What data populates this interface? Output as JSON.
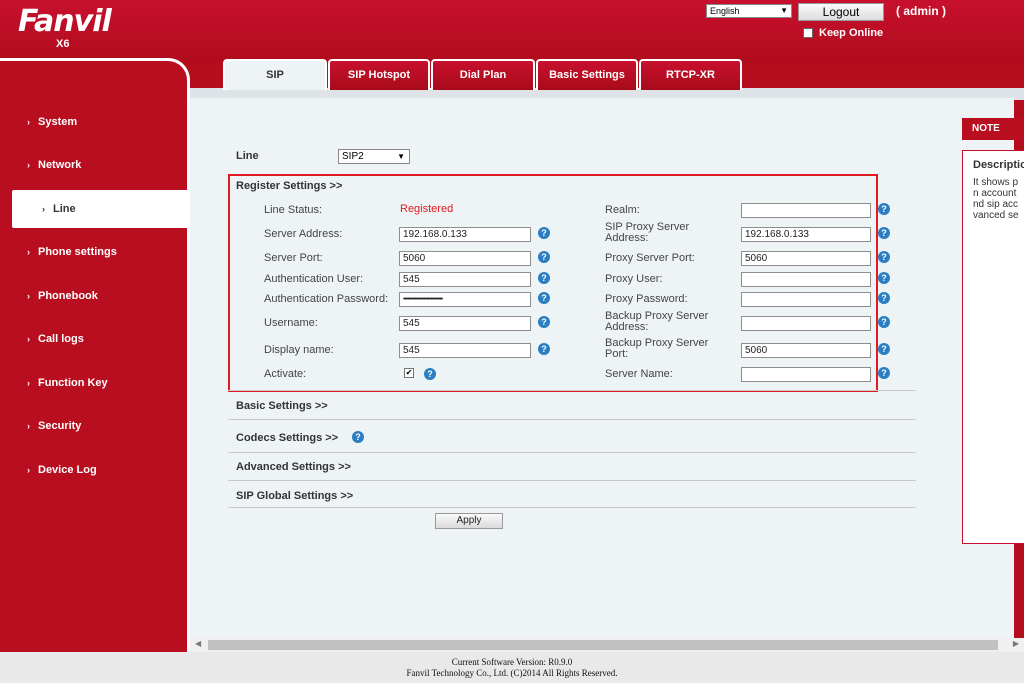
{
  "header": {
    "logo_text": "Fanvil",
    "model": "X6",
    "language": "English",
    "logout_label": "Logout",
    "user": "( admin )",
    "keep_online": "Keep Online"
  },
  "sidebar": {
    "items": [
      {
        "label": "System"
      },
      {
        "label": "Network"
      },
      {
        "label": "Line"
      },
      {
        "label": "Phone settings"
      },
      {
        "label": "Phonebook"
      },
      {
        "label": "Call logs"
      },
      {
        "label": "Function Key"
      },
      {
        "label": "Security"
      },
      {
        "label": "Device Log"
      }
    ],
    "active": "Line"
  },
  "tabs": [
    "SIP",
    "SIP Hotspot",
    "Dial Plan",
    "Basic Settings",
    "RTCP-XR"
  ],
  "line": {
    "label": "Line",
    "selected": "SIP2"
  },
  "register": {
    "title": "Register Settings >>",
    "line_status_label": "Line Status:",
    "line_status_value": "Registered",
    "server_address_label": "Server Address:",
    "server_address": "192.168.0.133",
    "server_port_label": "Server Port:",
    "server_port": "5060",
    "auth_user_label": "Authentication User:",
    "auth_user": "545",
    "auth_password_label": "Authentication Password:",
    "auth_password": "•••••••••••••••••••••••••••",
    "username_label": "Username:",
    "username": "545",
    "display_name_label": "Display name:",
    "display_name": "545",
    "activate_label": "Activate:",
    "activate_check": "✔",
    "realm_label": "Realm:",
    "realm": "",
    "proxy_server_addr_label_1": "SIP Proxy Server",
    "proxy_server_addr_label_2": "Address:",
    "proxy_server_addr": "192.168.0.133",
    "proxy_port_label": "Proxy Server Port:",
    "proxy_port": "5060",
    "proxy_user_label": "Proxy User:",
    "proxy_user": "",
    "proxy_password_label": "Proxy Password:",
    "proxy_password": "",
    "backup_proxy_addr_label_1": "Backup Proxy Server",
    "backup_proxy_addr_label_2": "Address:",
    "backup_proxy_addr": "",
    "backup_proxy_port_label_1": "Backup Proxy Server",
    "backup_proxy_port_label_2": "Port:",
    "backup_proxy_port": "5060",
    "server_name_label": "Server Name:",
    "server_name": ""
  },
  "sections": {
    "basic": "Basic Settings >>",
    "codecs": "Codecs Settings >>",
    "advanced": "Advanced Settings >>",
    "global": "SIP Global Settings >>"
  },
  "apply_label": "Apply",
  "help_glyph": "?",
  "note": {
    "title": "NOTE",
    "heading": "Description",
    "lines": [
      "It shows p",
      "n account",
      "nd sip acc",
      "vanced se"
    ]
  },
  "footer": {
    "line1": "Current Software Version: R0.9.0",
    "line2": "Fanvil Technology Co., Ltd. (C)2014 All Rights Reserved."
  },
  "colors": {
    "brand_red": "#b80e20",
    "status_red": "#e01b22",
    "help_blue": "#2a7ec1"
  }
}
